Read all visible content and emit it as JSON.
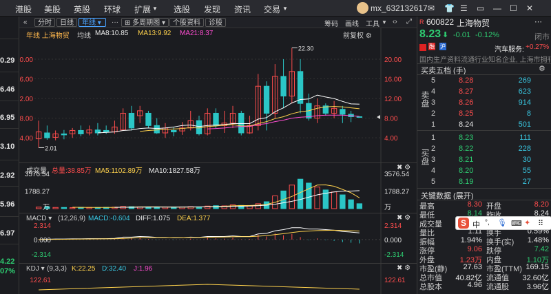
{
  "topnav": {
    "items": [
      "港股",
      "美股",
      "英股",
      "环球",
      "扩展",
      "选股",
      "发现",
      "资讯",
      "交易"
    ],
    "user": "mx_632132617"
  },
  "left_prices": [
    "0.29",
    "6.46",
    "6.95",
    "3.10",
    "2.92",
    "5.96",
    "6.97",
    "4.22",
    "07%"
  ],
  "toolbar": {
    "intraday": "分时",
    "daily": "日线",
    "yearly": "年线",
    "multi_period": "多周期图",
    "individual_info": "个股资料",
    "diagnose": "诊股",
    "right": [
      "筹码",
      "画线",
      "工具"
    ]
  },
  "chart_info": {
    "label": "年线 上海物贸",
    "ma_title": "均线",
    "ma8": "MA8:10.85",
    "ma13": "MA13:9.92",
    "ma21": "MA21:8.37",
    "restore": "前复权",
    "high_label": "22.30",
    "low_label": "2.01",
    "y_ticks": [
      "20.00",
      "16.00",
      "12.00",
      "8.00",
      "4.00"
    ]
  },
  "volume_info": {
    "title": "成交量",
    "total": "总量:38.85万",
    "ma5": "MA5:1102.89万",
    "ma10": "MA10:1827.58万",
    "y_ticks": [
      "3576.54",
      "1788.27",
      "万"
    ]
  },
  "macd_info": {
    "title": "MACD",
    "params": "(12,26,9)",
    "macd": "MACD:-0.604",
    "diff": "DIFF:1.075",
    "dea": "DEA:1.377",
    "y_ticks": [
      "2.314",
      "0.000",
      "-2.314"
    ]
  },
  "kdj_info": {
    "title": "KDJ",
    "params": "(9,3,3)",
    "k": "K:22.25",
    "d": "D:32.40",
    "j": "J:1.96",
    "y_ticks": [
      "122.61"
    ]
  },
  "chart_data": {
    "type": "candlestick",
    "title": "年线 上海物贸",
    "candles": [
      {
        "o": 3.8,
        "c": 5.2,
        "h": 7.5,
        "l": 2.0
      },
      {
        "o": 5.0,
        "c": 4.0,
        "h": 6.5,
        "l": 3.6
      },
      {
        "o": 4.1,
        "c": 4.8,
        "h": 5.5,
        "l": 3.5
      },
      {
        "o": 4.8,
        "c": 4.6,
        "h": 5.6,
        "l": 3.7
      },
      {
        "o": 4.8,
        "c": 5.5,
        "h": 6.0,
        "l": 4.0
      },
      {
        "o": 5.5,
        "c": 4.8,
        "h": 6.5,
        "l": 4.3
      },
      {
        "o": 5.0,
        "c": 5.6,
        "h": 6.5,
        "l": 4.5
      },
      {
        "o": 5.6,
        "c": 5.0,
        "h": 7.0,
        "l": 4.5
      },
      {
        "o": 5.5,
        "c": 5.2,
        "h": 6.5,
        "l": 4.8
      },
      {
        "o": 5.2,
        "c": 6.2,
        "h": 7.5,
        "l": 4.8
      },
      {
        "o": 5.6,
        "c": 9.0,
        "h": 10.0,
        "l": 5.5
      },
      {
        "o": 9.0,
        "c": 6.0,
        "h": 10.5,
        "l": 5.5
      },
      {
        "o": 8.5,
        "c": 9.5,
        "h": 10.5,
        "l": 7.0
      },
      {
        "o": 9.0,
        "c": 6.5,
        "h": 9.5,
        "l": 6.0
      },
      {
        "o": 6.5,
        "c": 5.0,
        "h": 8.0,
        "l": 4.8
      },
      {
        "o": 5.0,
        "c": 6.0,
        "h": 7.0,
        "l": 4.0
      },
      {
        "o": 5.5,
        "c": 5.2,
        "h": 6.2,
        "l": 4.3
      },
      {
        "o": 5.4,
        "c": 6.0,
        "h": 7.2,
        "l": 4.6
      },
      {
        "o": 6.0,
        "c": 7.5,
        "h": 9.5,
        "l": 5.5
      },
      {
        "o": 7.5,
        "c": 4.8,
        "h": 8.5,
        "l": 4.5
      },
      {
        "o": 4.8,
        "c": 9.0,
        "h": 10.0,
        "l": 4.5
      },
      {
        "o": 9.0,
        "c": 6.5,
        "h": 10.0,
        "l": 6.0
      },
      {
        "o": 6.5,
        "c": 7.0,
        "h": 9.5,
        "l": 5.0
      },
      {
        "o": 7.0,
        "c": 9.0,
        "h": 10.5,
        "l": 6.0
      },
      {
        "o": 9.0,
        "c": 5.0,
        "h": 9.5,
        "l": 4.5
      },
      {
        "o": 5.0,
        "c": 6.5,
        "h": 8.5,
        "l": 4.8
      },
      {
        "o": 6.5,
        "c": 14.5,
        "h": 17.0,
        "l": 5.5
      },
      {
        "o": 14.5,
        "c": 9.0,
        "h": 15.5,
        "l": 5.5
      },
      {
        "o": 9.0,
        "c": 16.5,
        "h": 19.0,
        "l": 8.0
      },
      {
        "o": 16.5,
        "c": 12.5,
        "h": 20.0,
        "l": 10.0
      },
      {
        "o": 12.5,
        "c": 17.5,
        "h": 22.3,
        "l": 11.0
      },
      {
        "o": 17.5,
        "c": 11.0,
        "h": 20.0,
        "l": 9.0
      },
      {
        "o": 11.0,
        "c": 8.0,
        "h": 13.0,
        "l": 7.5
      },
      {
        "o": 8.0,
        "c": 10.5,
        "h": 12.0,
        "l": 7.0
      },
      {
        "o": 10.5,
        "c": 9.0,
        "h": 11.0,
        "l": 8.5
      },
      {
        "o": 9.0,
        "c": 10.0,
        "h": 11.5,
        "l": 8.0
      },
      {
        "o": 9.8,
        "c": 8.8,
        "h": 10.5,
        "l": 7.0
      },
      {
        "o": 8.8,
        "c": 8.3,
        "h": 9.5,
        "l": 7.2
      },
      {
        "o": 8.3,
        "c": 8.23,
        "h": 8.3,
        "l": 8.14
      }
    ],
    "ma8": [
      null,
      null,
      null,
      null,
      null,
      null,
      null,
      5.0,
      5.1,
      5.2,
      5.5,
      5.6,
      5.9,
      6.0,
      5.9,
      6.0,
      6.2,
      6.5,
      6.6,
      6.3,
      6.5,
      6.6,
      6.7,
      6.9,
      6.9,
      6.9,
      7.8,
      8.1,
      9.3,
      10.1,
      11.1,
      11.8,
      11.9,
      12.7,
      12.3,
      12.0,
      11.4,
      10.9,
      10.85
    ],
    "ma13": [
      null,
      null,
      null,
      null,
      null,
      null,
      null,
      null,
      null,
      null,
      null,
      null,
      5.3,
      5.5,
      5.6,
      5.7,
      5.8,
      5.9,
      6.1,
      6.0,
      6.3,
      6.4,
      6.6,
      6.7,
      6.4,
      6.4,
      6.9,
      7.3,
      7.9,
      8.3,
      8.9,
      9.3,
      9.5,
      10.0,
      10.3,
      10.4,
      10.3,
      10.1,
      9.92
    ],
    "ma21": [
      null,
      null,
      null,
      null,
      null,
      null,
      null,
      null,
      null,
      null,
      null,
      null,
      null,
      null,
      null,
      null,
      null,
      null,
      null,
      null,
      5.8,
      5.9,
      6.0,
      6.2,
      6.3,
      6.3,
      6.7,
      6.9,
      7.3,
      7.6,
      8.0,
      8.2,
      8.3,
      8.5,
      8.6,
      8.6,
      8.6,
      8.5,
      8.37
    ],
    "volume": [
      150,
      180,
      120,
      120,
      100,
      130,
      120,
      110,
      130,
      150,
      220,
      200,
      180,
      160,
      140,
      150,
      150,
      160,
      200,
      180,
      260,
      300,
      280,
      380,
      330,
      320,
      500,
      700,
      1300,
      1800,
      2400,
      3000,
      2600,
      2200,
      1900,
      1700,
      1400,
      900,
      500
    ],
    "vol_ma5": [
      null,
      null,
      null,
      null,
      140,
      136,
      118,
      118,
      122,
      128,
      146,
      162,
      176,
      182,
      180,
      166,
      156,
      152,
      160,
      168,
      188,
      220,
      248,
      290,
      316,
      318,
      358,
      440,
      640,
      924,
      1244,
      1640,
      2020,
      2400,
      2420,
      2280,
      1960,
      1620,
      1100
    ],
    "vol_ma10": [
      null,
      null,
      null,
      null,
      null,
      null,
      null,
      null,
      null,
      131,
      138,
      140,
      146,
      152,
      156,
      158,
      159,
      164,
      172,
      177,
      181,
      191,
      204,
      226,
      245,
      262,
      300,
      349,
      451,
      594,
      741,
      936,
      1174,
      1404,
      1562,
      1700,
      1780,
      1790,
      1827
    ],
    "macd_bar": [
      0.05,
      0.1,
      0.08,
      0.05,
      0.02,
      0.0,
      0.05,
      0.03,
      0.0,
      0.08,
      0.3,
      0.2,
      0.25,
      0.1,
      -0.05,
      0.0,
      -0.05,
      0.02,
      0.15,
      0.0,
      0.3,
      0.2,
      0.15,
      0.3,
      0.05,
      0.1,
      0.8,
      0.5,
      1.0,
      0.7,
      0.9,
      0.4,
      -0.1,
      0.2,
      -0.1,
      -0.2,
      -0.4,
      -0.5,
      -0.604
    ],
    "dif": [
      0,
      0.05,
      0.1,
      0.1,
      0.12,
      0.12,
      0.15,
      0.15,
      0.15,
      0.2,
      0.4,
      0.4,
      0.5,
      0.45,
      0.35,
      0.35,
      0.3,
      0.32,
      0.4,
      0.35,
      0.5,
      0.5,
      0.5,
      0.6,
      0.5,
      0.5,
      0.9,
      1.0,
      1.4,
      1.6,
      1.9,
      1.9,
      1.7,
      1.7,
      1.6,
      1.5,
      1.3,
      1.2,
      1.075
    ],
    "dea": [
      0,
      0.02,
      0.04,
      0.05,
      0.07,
      0.08,
      0.1,
      0.11,
      0.12,
      0.14,
      0.2,
      0.25,
      0.3,
      0.32,
      0.33,
      0.33,
      0.33,
      0.33,
      0.34,
      0.34,
      0.37,
      0.4,
      0.42,
      0.45,
      0.46,
      0.47,
      0.55,
      0.64,
      0.79,
      0.95,
      1.14,
      1.29,
      1.37,
      1.44,
      1.48,
      1.5,
      1.47,
      1.42,
      1.377
    ],
    "ylim_price": [
      1.5,
      23.5
    ],
    "ylim_volume": [
      0,
      3576.54
    ],
    "ylim_macd": [
      -2.314,
      2.314
    ]
  },
  "quote": {
    "prefix": "R",
    "code": "600822",
    "name": "上海物贸",
    "price": "8.23",
    "change": "-0.01",
    "pct": "-0.12%",
    "status": "闭市",
    "tags": [
      "融",
      "沪",
      "深"
    ],
    "sector": "汽车服务:",
    "sector_pct": "+0.27%",
    "desc": "国内生产资料流通行业知名企业, 上海市拥有..."
  },
  "orderbook": {
    "title": "买卖五档 (手)",
    "sell_label": "卖盘",
    "buy_label": "买盘",
    "sell": [
      [
        "5",
        "8.28",
        "269"
      ],
      [
        "4",
        "8.27",
        "623"
      ],
      [
        "3",
        "8.26",
        "914"
      ],
      [
        "2",
        "8.25",
        "8"
      ],
      [
        "1",
        "8.24",
        "501"
      ]
    ],
    "buy": [
      [
        "1",
        "8.23",
        "111"
      ],
      [
        "2",
        "8.22",
        "228"
      ],
      [
        "3",
        "8.21",
        "30"
      ],
      [
        "4",
        "8.20",
        "55"
      ],
      [
        "5",
        "8.19",
        "27"
      ]
    ]
  },
  "keydata": {
    "title": "关键数据 (展开)",
    "rows": [
      [
        "最高",
        "8.30",
        "开盘",
        "8.20"
      ],
      [
        "最低",
        "8.14",
        "昨收",
        "8.24"
      ],
      [
        "成交量",
        "2.33",
        "",
        ""
      ],
      [
        "量比",
        "1.11",
        "换手",
        "0.59%"
      ],
      [
        "振幅",
        "1.94%",
        "换手(实)",
        "1.48%"
      ],
      [
        "涨停",
        "9.06",
        "跌停",
        "7.42"
      ],
      [
        "外盘",
        "1.23万",
        "内盘",
        "1.10万"
      ],
      [
        "市盈(静)",
        "27.63",
        "市盈(TTM)",
        "169.15"
      ],
      [
        "总市值",
        "40.82亿",
        "流通值",
        "32.60亿"
      ],
      [
        "总股本",
        "4.96",
        "流通股",
        "3.96亿"
      ]
    ]
  },
  "ime": {
    "letter": "S",
    "items": [
      "中",
      "°,",
      "🎤",
      "▦",
      "👕",
      "⠿"
    ]
  },
  "colors": {
    "up": "#ff4d4d",
    "down": "#2bc6c6",
    "ma8": "#ffffff",
    "ma13": "#ffd24d",
    "ma21": "#ff4dd2",
    "bg": "#1b1c20"
  }
}
